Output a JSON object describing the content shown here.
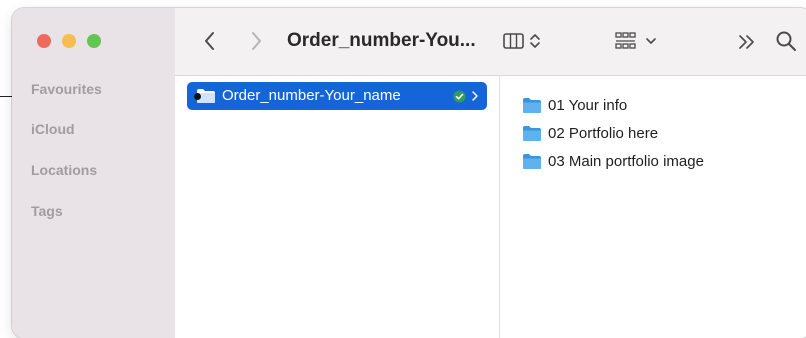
{
  "window": {
    "title": "Order_number-You..."
  },
  "sidebar": {
    "sections": [
      {
        "label": "Favourites"
      },
      {
        "label": "iCloud"
      },
      {
        "label": "Locations"
      },
      {
        "label": "Tags"
      }
    ]
  },
  "toolbar": {
    "back_icon": "chevron-left-icon",
    "forward_icon": "chevron-right-icon",
    "view_icon": "columns-view-icon",
    "group_icon": "grid-group-icon",
    "more_icon": "double-chevron-icon",
    "search_icon": "search-icon"
  },
  "column1": {
    "selected_folder": {
      "label": "Order_number-Your_name",
      "status": "synced"
    }
  },
  "column2": {
    "items": [
      {
        "label": "01 Your info"
      },
      {
        "label": "02 Portfolio here"
      },
      {
        "label": "03 Main portfolio image"
      }
    ]
  },
  "colors": {
    "selection": "#1466d8",
    "sidebar_bg": "#e9e2e6",
    "folder": "#3fa0e6",
    "sync_badge": "#2f9e5b"
  }
}
